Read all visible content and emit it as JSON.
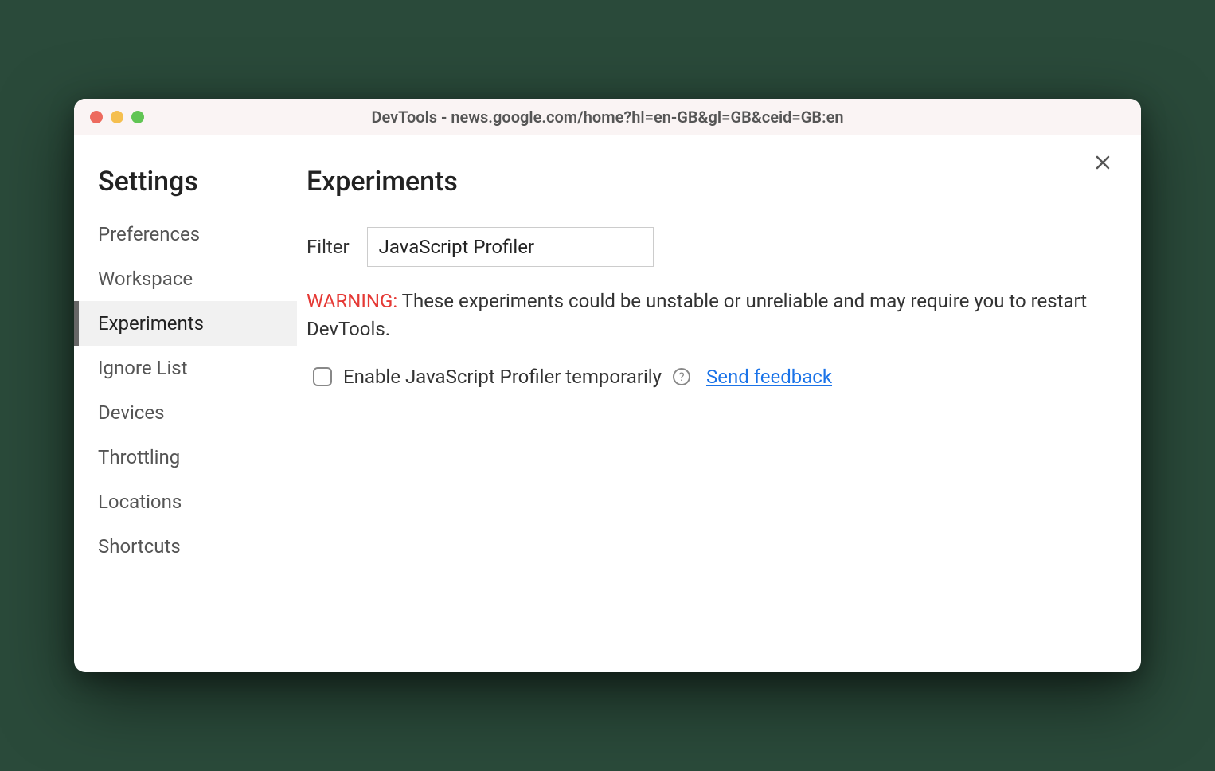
{
  "window": {
    "title": "DevTools - news.google.com/home?hl=en-GB&gl=GB&ceid=GB:en"
  },
  "sidebar": {
    "title": "Settings",
    "items": [
      {
        "label": "Preferences",
        "selected": false
      },
      {
        "label": "Workspace",
        "selected": false
      },
      {
        "label": "Experiments",
        "selected": true
      },
      {
        "label": "Ignore List",
        "selected": false
      },
      {
        "label": "Devices",
        "selected": false
      },
      {
        "label": "Throttling",
        "selected": false
      },
      {
        "label": "Locations",
        "selected": false
      },
      {
        "label": "Shortcuts",
        "selected": false
      }
    ]
  },
  "main": {
    "title": "Experiments",
    "filter": {
      "label": "Filter",
      "value": "JavaScript Profiler"
    },
    "warning": {
      "label": "WARNING:",
      "text": " These experiments could be unstable or unreliable and may require you to restart DevTools."
    },
    "experiment": {
      "label": "Enable JavaScript Profiler temporarily",
      "checked": false,
      "help_glyph": "?",
      "feedback_link": "Send feedback"
    }
  }
}
